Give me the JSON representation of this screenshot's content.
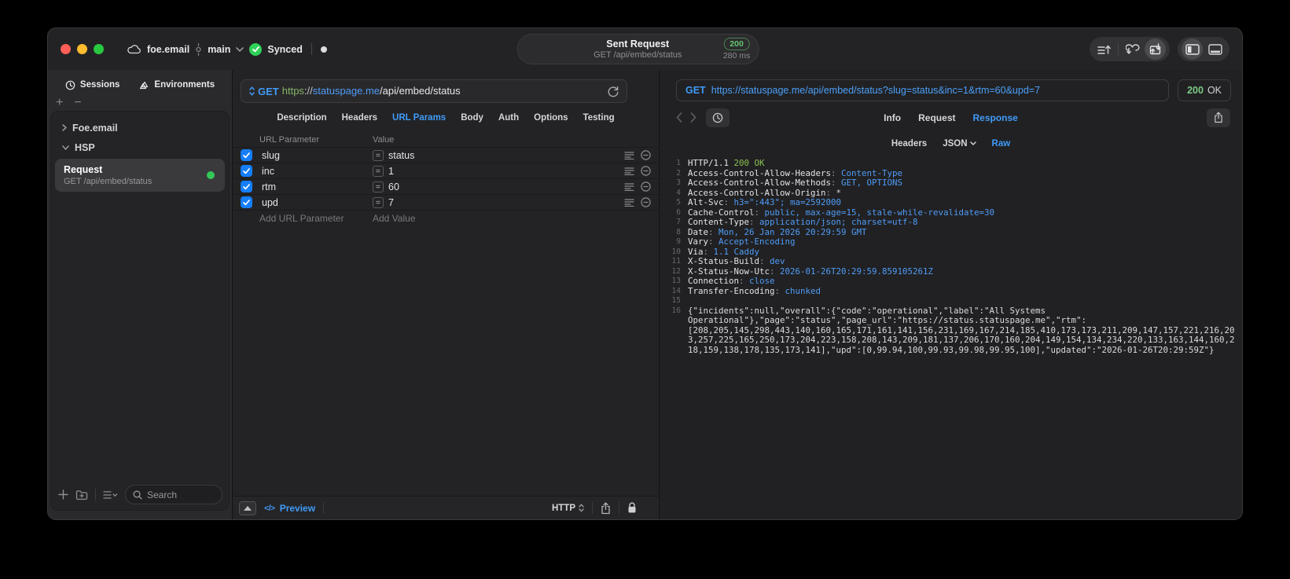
{
  "colors": {
    "accent_blue": "#3f9bf8",
    "green": "#30d158",
    "status_green": "#8cc152"
  },
  "icons": {
    "equals": "=",
    "code": "</>"
  },
  "titlebar": {
    "project": "foe.email",
    "branch": "main",
    "sync_status": "Synced",
    "request_title": "Sent Request",
    "request_subtitle": "GET /api/embed/status",
    "status_code": "200",
    "duration": "280 ms"
  },
  "sidebar": {
    "tabs": [
      {
        "label": "Sessions"
      },
      {
        "label": "Environments"
      }
    ],
    "tree": [
      {
        "label": "Foe.email"
      },
      {
        "label": "HSP"
      }
    ],
    "request_item": {
      "title": "Request",
      "subtitle": "GET /api/embed/status"
    },
    "search_placeholder": "Search"
  },
  "request_pane": {
    "method": "GET",
    "url": {
      "scheme": "https",
      "separator": "://",
      "host": "statuspage.me",
      "path": "/api/embed/status"
    },
    "tabs": [
      {
        "label": "Description"
      },
      {
        "label": "Headers"
      },
      {
        "label": "URL Params"
      },
      {
        "label": "Body"
      },
      {
        "label": "Auth"
      },
      {
        "label": "Options"
      },
      {
        "label": "Testing"
      }
    ],
    "active_tab": "URL Params",
    "params": {
      "columns": {
        "name": "URL Parameter",
        "value": "Value"
      },
      "rows": [
        {
          "enabled": true,
          "name": "slug",
          "value": "status"
        },
        {
          "enabled": true,
          "name": "inc",
          "value": "1"
        },
        {
          "enabled": true,
          "name": "rtm",
          "value": "60"
        },
        {
          "enabled": true,
          "name": "upd",
          "value": "7"
        }
      ],
      "add_name": "Add URL Parameter",
      "add_value": "Add Value"
    },
    "footer": {
      "preview": "Preview",
      "protocol": "HTTP"
    }
  },
  "response_pane": {
    "method": "GET",
    "url": "https://statuspage.me/api/embed/status?slug=status&inc=1&rtm=60&upd=7",
    "status_code": "200",
    "status_text": "OK",
    "tabs": [
      {
        "label": "Info"
      },
      {
        "label": "Request"
      },
      {
        "label": "Response"
      }
    ],
    "active_tab": "Response",
    "subtabs": [
      {
        "label": "Headers"
      },
      {
        "label": "JSON"
      },
      {
        "label": "Raw"
      }
    ],
    "active_subtab": "Raw",
    "status_line": {
      "n": "1",
      "protocol": "HTTP/1.1",
      "status": "200 OK"
    },
    "headers": [
      {
        "n": "2",
        "name": "Access-Control-Allow-Headers",
        "value": "Content-Type"
      },
      {
        "n": "3",
        "name": "Access-Control-Allow-Methods",
        "value": "GET, OPTIONS"
      },
      {
        "n": "4",
        "name": "Access-Control-Allow-Origin",
        "value": "*"
      },
      {
        "n": "5",
        "name": "Alt-Svc",
        "value": "h3=\":443\"; ma=2592000"
      },
      {
        "n": "6",
        "name": "Cache-Control",
        "value": "public, max-age=15, stale-while-revalidate=30"
      },
      {
        "n": "7",
        "name": "Content-Type",
        "value": "application/json; charset=utf-8"
      },
      {
        "n": "8",
        "name": "Date",
        "value": "Mon, 26 Jan 2026 20:29:59 GMT"
      },
      {
        "n": "9",
        "name": "Vary",
        "value": "Accept-Encoding"
      },
      {
        "n": "10",
        "name": "Via",
        "value": "1.1 Caddy"
      },
      {
        "n": "11",
        "name": "X-Status-Build",
        "value": "dev"
      },
      {
        "n": "12",
        "name": "X-Status-Now-Utc",
        "value": "2026-01-26T20:29:59.859105261Z"
      },
      {
        "n": "13",
        "name": "Connection",
        "value": "close"
      },
      {
        "n": "14",
        "name": "Transfer-Encoding",
        "value": "chunked"
      }
    ],
    "blank_line_n": "15",
    "body_line_n": "16",
    "body": "{\"incidents\":null,\"overall\":{\"code\":\"operational\",\"label\":\"All Systems Operational\"},\"page\":\"status\",\"page_url\":\"https://status.statuspage.me\",\"rtm\":[208,205,145,298,443,140,160,165,171,161,141,156,231,169,167,214,185,410,173,173,211,209,147,157,221,216,203,257,225,165,250,173,204,223,158,208,143,209,181,137,206,170,160,204,149,154,134,234,220,133,163,144,160,218,159,138,178,135,173,141],\"upd\":[0,99.94,100,99.93,99.98,99.95,100],\"updated\":\"2026-01-26T20:29:59Z\"}"
  }
}
